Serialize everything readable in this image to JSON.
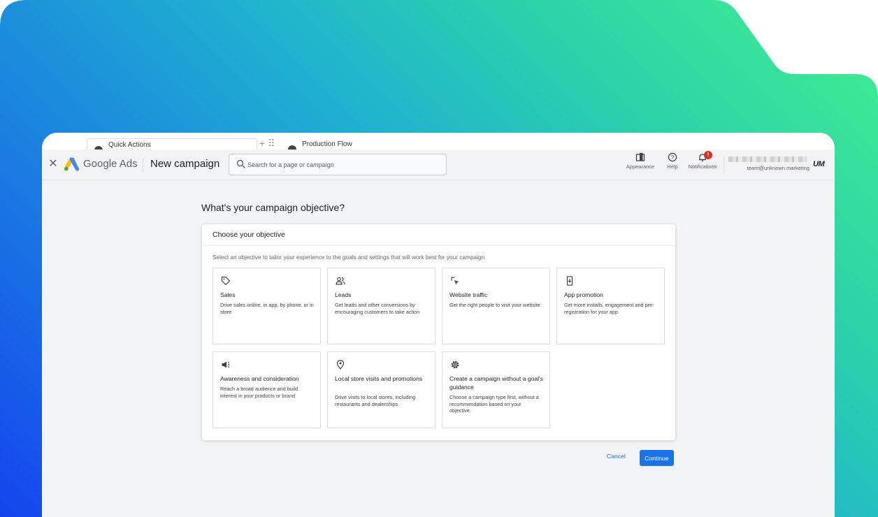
{
  "browser_tabs": [
    {
      "label": "Quick Actions"
    },
    {
      "label": "Production Flow"
    }
  ],
  "header": {
    "brand": "Google Ads",
    "page_title": "New campaign",
    "search_placeholder": "Search for a page or campaign",
    "actions": {
      "appearance": "Appearance",
      "help": "Help",
      "notifications": "Notifications",
      "notification_badge": "!"
    },
    "account_email": "team@unknown.marketing",
    "account_logo": "UM"
  },
  "main": {
    "heading": "What's your campaign objective?",
    "card_title": "Choose your objective",
    "card_description": "Select an objective to tailor your experience to the goals and settings that will work best for your campaign",
    "objectives": [
      {
        "icon": "tag-icon",
        "title": "Sales",
        "description": "Drive sales online, in app, by phone, or in store"
      },
      {
        "icon": "people-icon",
        "title": "Leads",
        "description": "Get leads and other conversions by encouraging customers to take action"
      },
      {
        "icon": "click-icon",
        "title": "Website traffic",
        "description": "Get the right people to visit your website"
      },
      {
        "icon": "phone-icon",
        "title": "App promotion",
        "description": "Get more installs, engagement and pre-registration for your app"
      },
      {
        "icon": "megaphone-icon",
        "title": "Awareness and consideration",
        "description": "Reach a broad audience and build interest in your products or brand"
      },
      {
        "icon": "location-pin-icon",
        "title": "Local store visits and promotions",
        "description": "Drive visits to local stores, including restaurants and dealerships."
      },
      {
        "icon": "gear-icon",
        "title": "Create a campaign without a goal's guidance",
        "description": "Choose a campaign type first, without a recommendation based on your objective."
      }
    ]
  },
  "footer": {
    "cancel_label": "Cancel",
    "continue_label": "Continue"
  },
  "colors": {
    "accent": "#1a73e8",
    "badge": "#d93025",
    "gradient_start": "#1444ee",
    "gradient_end": "#43ef8f"
  }
}
